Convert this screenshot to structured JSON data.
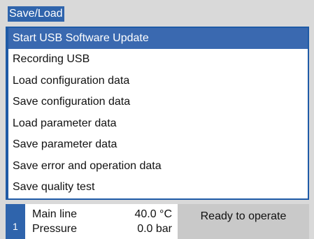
{
  "window": {
    "title": "Save/Load"
  },
  "menu": {
    "items": [
      {
        "label": "Start USB Software Update",
        "selected": true
      },
      {
        "label": "Recording USB",
        "selected": false
      },
      {
        "label": "Load configuration data",
        "selected": false
      },
      {
        "label": "Save configuration data",
        "selected": false
      },
      {
        "label": "Load parameter data",
        "selected": false
      },
      {
        "label": "Save parameter data",
        "selected": false
      },
      {
        "label": "Save error and operation data",
        "selected": false
      },
      {
        "label": "Save quality test",
        "selected": false
      }
    ]
  },
  "status": {
    "index": "1",
    "line1_label": "Main line",
    "line1_value": "40.0 °C",
    "line2_label": "Pressure",
    "line2_value": "0.0 bar",
    "message": "Ready to operate"
  },
  "colors": {
    "accent": "#2f64ac",
    "selection": "#3a69b0",
    "background": "#d9d9d9"
  }
}
